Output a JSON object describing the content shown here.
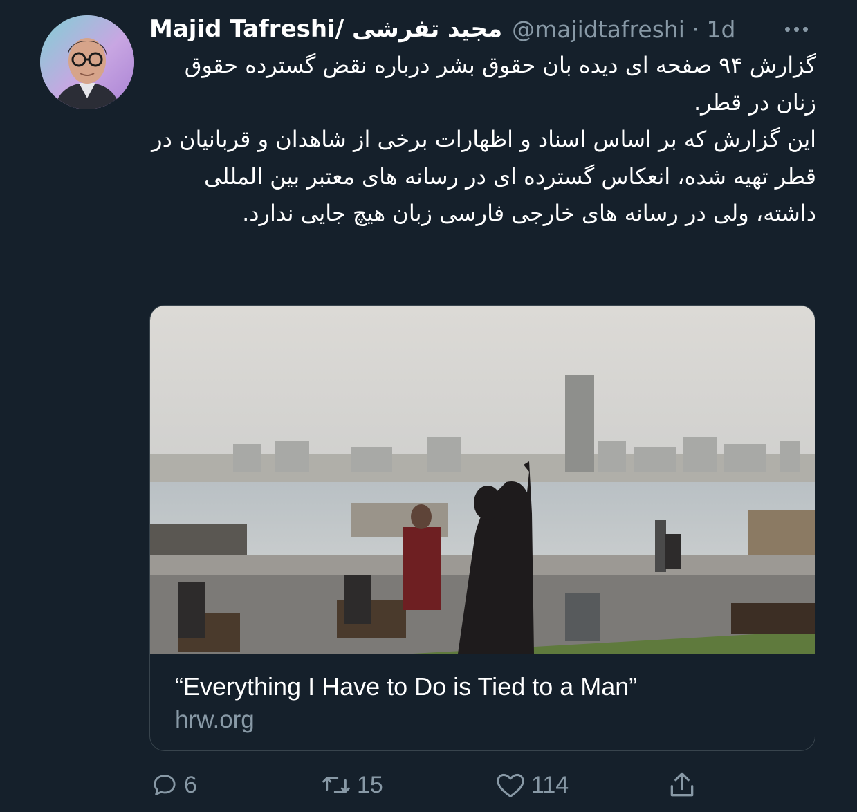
{
  "tweet": {
    "author_name": "Majid Tafreshi/ مجید تفرشی",
    "handle_and_time": "@majidtafreshi · 1d",
    "more_icon": "more-horizontal-icon",
    "text_paragraphs": [
      "گزارش ۹۴ صفحه ای دیده بان حقوق بشر درباره نقض گسترده حقوق زنان در قطر.",
      "این گزارش که بر اساس اسناد و اظهارات برخی از شاهدان و قربانیان در قطر تهیه شده، انعکاس گسترده ای در رسانه های معتبر بین المللی داشته، ولی در رسانه های خارجی فارسی زبان هیچ جایی ندارد."
    ]
  },
  "link_card": {
    "title": "“Everything I Have to Do is Tied to a Man”",
    "domain": "hrw.org"
  },
  "actions": {
    "reply_count": "6",
    "retweet_count": "15",
    "like_count": "114"
  },
  "colors": {
    "background": "#15202b",
    "secondary_text": "#8899a6",
    "border": "#38444d"
  }
}
